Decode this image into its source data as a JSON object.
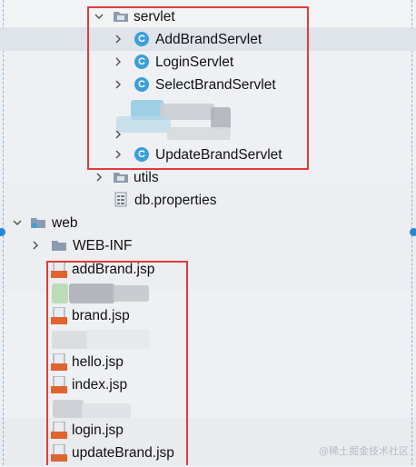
{
  "tree": {
    "servlet": {
      "label": "servlet",
      "children": [
        "AddBrandServlet",
        "LoginServlet",
        "SelectBrandServlet",
        "UpdateBrandServlet"
      ]
    },
    "utils": {
      "label": "utils"
    },
    "db_properties": {
      "label": "db.properties"
    },
    "web": {
      "label": "web"
    },
    "web_inf": {
      "label": "WEB-INF"
    },
    "jsp_files": [
      "addBrand.jsp",
      "brand.jsp",
      "hello.jsp",
      "index.jsp",
      "login.jsp",
      "updateBrand.jsp"
    ]
  },
  "icons": {
    "class_letter": "C",
    "jsp_badge": "JSP"
  },
  "watermark": "@稀土掘金技术社区",
  "colors": {
    "highlight_box": "#e23b3b",
    "class_icon": "#3c9fd8",
    "jsp_badge": "#e0642e",
    "folder": "#8c9bb0"
  }
}
